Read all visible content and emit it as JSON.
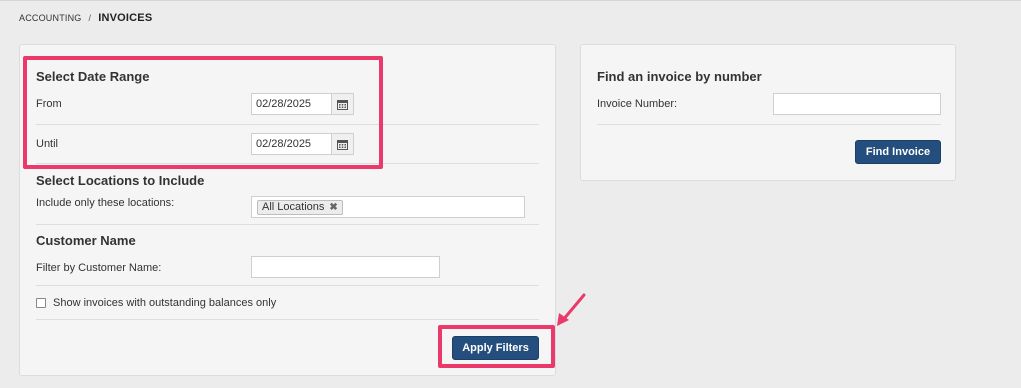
{
  "breadcrumb": {
    "parent": "ACCOUNTING",
    "separator": "/",
    "current": "INVOICES"
  },
  "filters": {
    "date_range": {
      "title": "Select Date Range",
      "from_label": "From",
      "from_value": "02/28/2025",
      "until_label": "Until",
      "until_value": "02/28/2025"
    },
    "locations": {
      "title": "Select Locations to Include",
      "label": "Include only these locations:",
      "selected_tag": "All Locations",
      "remove_glyph": "✖"
    },
    "customer": {
      "title": "Customer Name",
      "label": "Filter by Customer Name:",
      "value": ""
    },
    "outstanding_only": {
      "label": "Show invoices with outstanding balances only",
      "checked": false
    },
    "apply_label": "Apply Filters"
  },
  "find_invoice": {
    "title": "Find an invoice by number",
    "label": "Invoice Number:",
    "value": "",
    "button_label": "Find Invoice"
  },
  "colors": {
    "primary_button": "#244e7d",
    "highlight": "#ea3a6c",
    "panel_bg": "#f5f5f5",
    "page_bg": "#ececec"
  },
  "icons": {
    "calendar": "calendar-icon",
    "annotation_arrow": "arrow-icon"
  }
}
